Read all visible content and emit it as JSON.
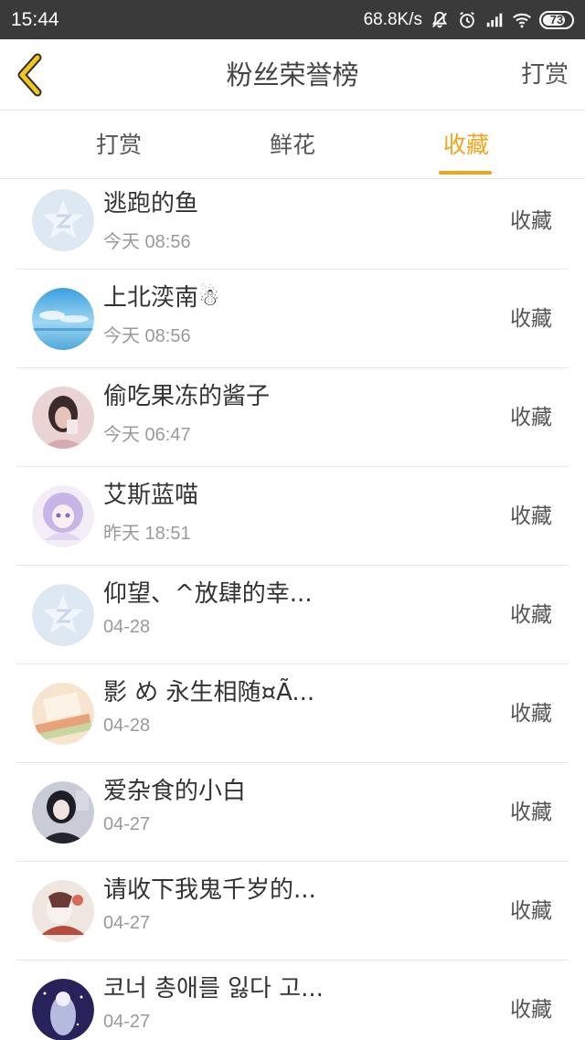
{
  "status_bar": {
    "time": "15:44",
    "net_speed": "68.8K/s",
    "battery": "73"
  },
  "nav": {
    "title": "粉丝荣誉榜",
    "right_action": "打赏"
  },
  "tabs": [
    {
      "label": "打赏",
      "active": false
    },
    {
      "label": "鲜花",
      "active": false
    },
    {
      "label": "收藏",
      "active": true
    }
  ],
  "accent_color": "#f0a51c",
  "items": [
    {
      "name": "逃跑的鱼",
      "date": "今天 08:56",
      "action": "收藏"
    },
    {
      "name": "上北湙南☃",
      "date": "今天 08:56",
      "action": "收藏"
    },
    {
      "name": "偷吃果冻的酱子",
      "date": "今天 06:47",
      "action": "收藏"
    },
    {
      "name": "艾斯蓝喵",
      "date": "昨天 18:51",
      "action": "收藏"
    },
    {
      "name": "仰望、^放肆的幸...",
      "date": "04-28",
      "action": "收藏"
    },
    {
      "name": "影 め 永生相随¤Ã...",
      "date": "04-28",
      "action": "收藏"
    },
    {
      "name": "爱杂食的小白",
      "date": "04-27",
      "action": "收藏"
    },
    {
      "name": "请收下我鬼千岁的...",
      "date": "04-27",
      "action": "收藏"
    },
    {
      "name": "코너 총애를 잃다 고...",
      "date": "04-27",
      "action": "收藏"
    }
  ]
}
